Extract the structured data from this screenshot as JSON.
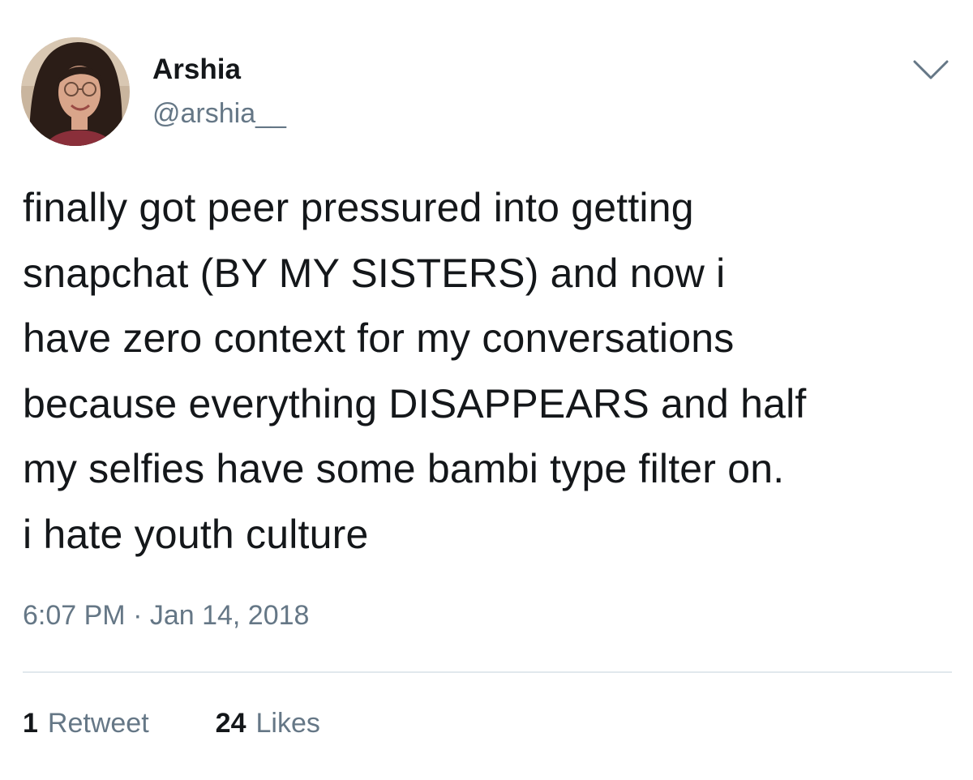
{
  "author": {
    "display_name": "Arshia",
    "handle": "@arshia__"
  },
  "tweet": {
    "lines": [
      "finally got peer pressured into getting",
      "snapchat (BY MY SISTERS) and now i",
      "have zero context for my conversations",
      "because everything DISAPPEARS and half",
      "my selfies have some bambi type filter on.",
      "i hate youth culture"
    ],
    "timestamp": "6:07 PM · Jan 14, 2018"
  },
  "stats": {
    "retweets_count": "1",
    "retweets_label": "Retweet",
    "likes_count": "24",
    "likes_label": "Likes"
  },
  "icons": {
    "menu": "chevron-down-icon"
  },
  "colors": {
    "text": "#14171a",
    "secondary": "#657786",
    "divider": "#e1e8ed"
  }
}
